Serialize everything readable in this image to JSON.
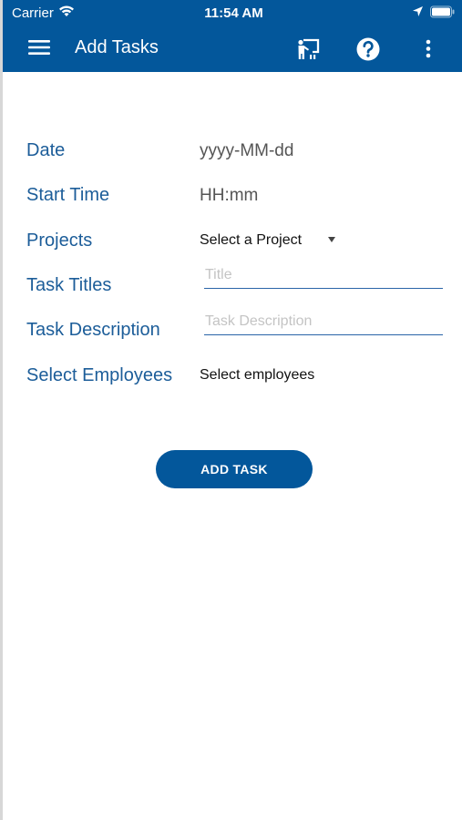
{
  "status_bar": {
    "carrier": "Carrier",
    "time": "11:54 AM",
    "icons": [
      "wifi-icon",
      "location-arrow-icon",
      "battery-icon"
    ]
  },
  "app_bar": {
    "title": "Add Tasks",
    "icons": [
      "hamburger-menu-icon",
      "presentation-board-icon",
      "help-icon",
      "more-vert-icon"
    ],
    "background": "#03579b"
  },
  "form": {
    "date": {
      "label": "Date",
      "value": "yyyy-MM-dd"
    },
    "start_time": {
      "label": "Start Time",
      "value": "HH:mm"
    },
    "projects": {
      "label": "Projects",
      "selected": "Select a Project"
    },
    "task_titles": {
      "label": "Task Titles",
      "placeholder": "Title",
      "value": ""
    },
    "task_description": {
      "label": "Task Description",
      "placeholder": "Task Description",
      "value": ""
    },
    "employees": {
      "label": "Select Employees",
      "selected": "Select employees"
    }
  },
  "actions": {
    "add_task_label": "ADD TASK"
  },
  "colors": {
    "primary": "#03579b",
    "label": "#1c5d99",
    "underline": "#2a64a8"
  }
}
